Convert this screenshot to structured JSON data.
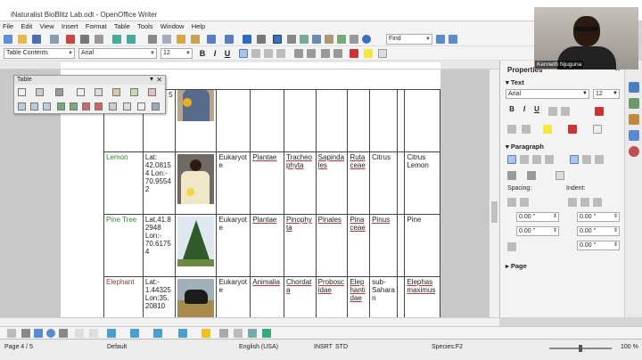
{
  "window": {
    "title": "iNaturalist BioBlitz Lab.odt - OpenOffice Writer"
  },
  "menu": [
    "File",
    "Edit",
    "View",
    "Insert",
    "Format",
    "Table",
    "Tools",
    "Window",
    "Help"
  ],
  "toolbar": {
    "find_placeholder": "Find"
  },
  "format_bar": {
    "style": "Table Contents",
    "font": "Arial",
    "size": "12"
  },
  "table_toolbar": {
    "title": "Table"
  },
  "table": {
    "rows": [
      {
        "common": "",
        "location": "",
        "photo": "person-with-orange",
        "domain": "",
        "kingdom": "",
        "phylum": "",
        "class": "",
        "order": "",
        "family": "",
        "genus": "",
        "species": ""
      },
      {
        "common": "Lemon",
        "location": "Lat: 42.0815 4 Lon:- 70.9554 2",
        "photo": "person-with-lemon",
        "domain": "Eukaryot e",
        "kingdom": "Plantae",
        "phylum": "Tracheo phyta",
        "class": "Sapinda les",
        "order": "Ruta ceae",
        "family": "Citrus",
        "genus": "",
        "species": "Citrus Lemon"
      },
      {
        "common": "Pine Tree",
        "location": "Lat,41.8 2948 Lon:- 70.6175 4",
        "photo": "pine-tree",
        "domain": "Eukaryot e",
        "kingdom": "Plantae",
        "phylum": "Pinophy ta",
        "class": "Pinales",
        "order": "Pina ceae",
        "family": "Pinus",
        "genus": "",
        "species": "Pine"
      },
      {
        "common": "Elephant",
        "location": "Lat:- 1.44325 Lon:35. 20810",
        "photo": "elephant",
        "domain": "Eukaryot e",
        "kingdom": "Animalia",
        "phylum": "Chordat a",
        "class": "Probosc idae",
        "order": "Elep hanti dae",
        "family": "sub- Sahara n",
        "genus": "",
        "species": "Elephas maximus"
      }
    ],
    "row0_fragment": "5"
  },
  "sidebar": {
    "title": "Properties",
    "text_section": "Text",
    "font": "Arial",
    "size": "12",
    "paragraph_section": "Paragraph",
    "spacing_label": "Spacing:",
    "indent_label": "Indent:",
    "spacing_above": "0.00 \"",
    "spacing_below": "0.00 \"",
    "indent_before": "0.00 \"",
    "indent_after": "0.00 \"",
    "indent_first": "0.00 \"",
    "page_section": "Page"
  },
  "webcam": {
    "name": "Kenneth Njuguna"
  },
  "status": {
    "page": "Page 4 / 5",
    "style": "Default",
    "lang": "English (USA)",
    "insrt": "INSRT",
    "std": "STD",
    "cell": "Species:F2",
    "zoom": "100 %",
    "zoom_level": 0.5
  },
  "colors": {
    "accent": "#2a8a2a",
    "elephant": "#8a3a2a"
  }
}
